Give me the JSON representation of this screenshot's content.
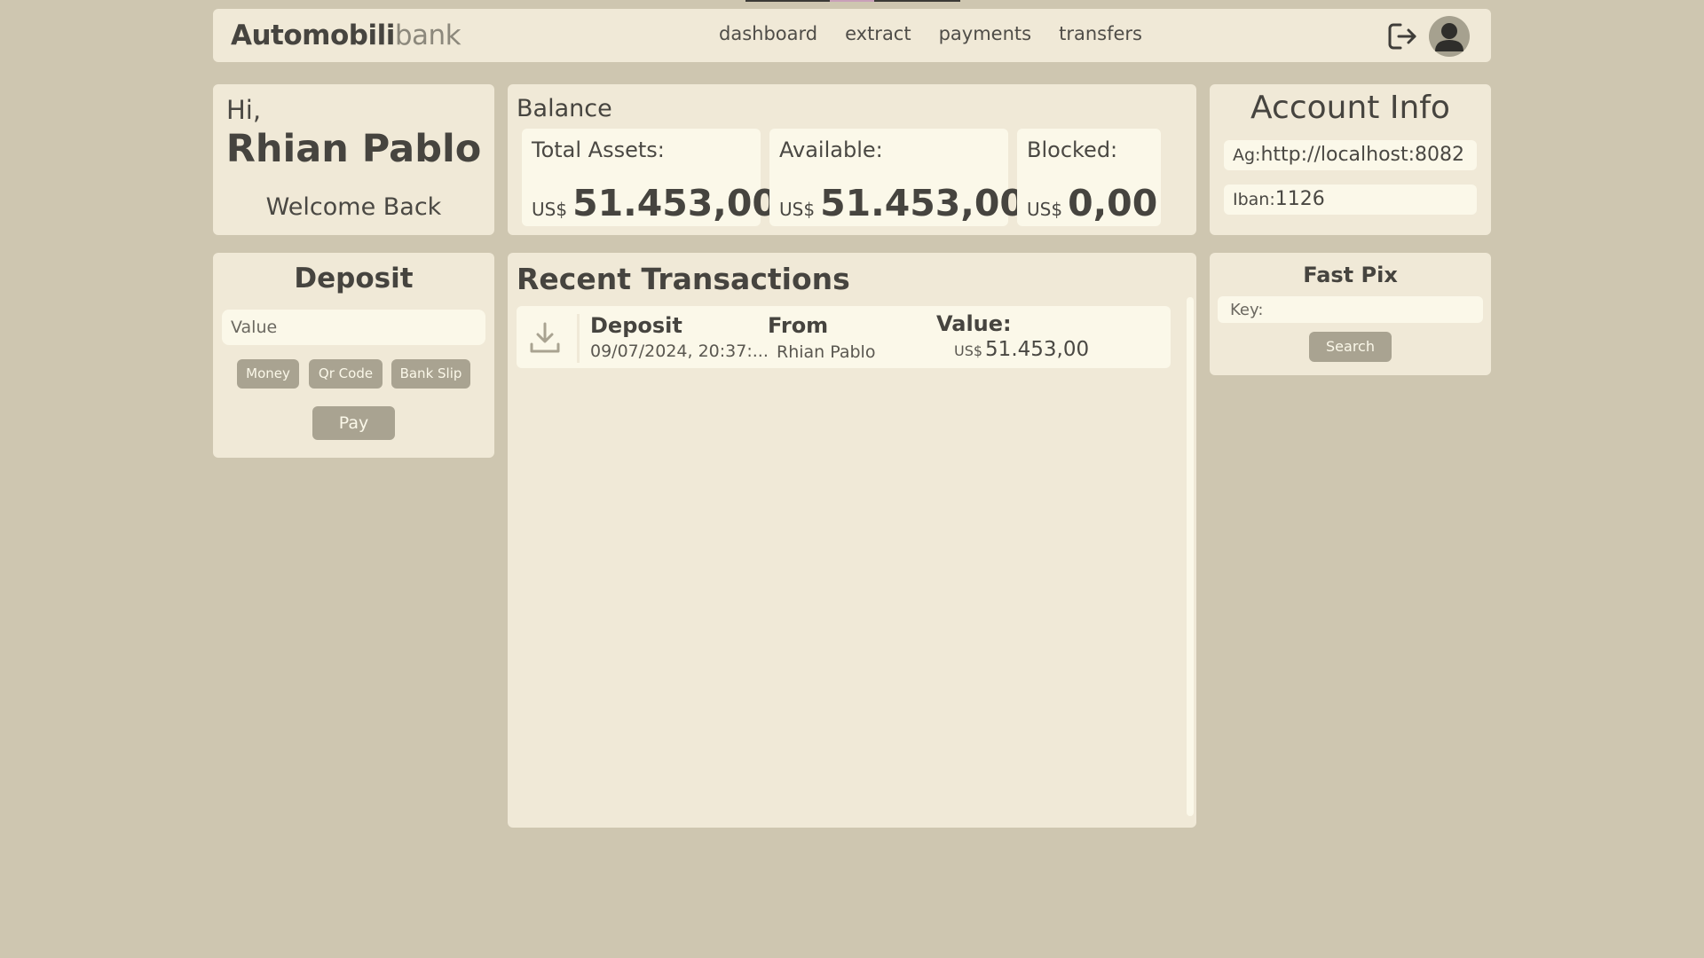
{
  "header": {
    "brand_strong": "Automobili",
    "brand_light": "bank",
    "nav": [
      "dashboard",
      "extract",
      "payments",
      "transfers"
    ],
    "icons": {
      "logout": "logout-icon",
      "avatar": "user-avatar-icon"
    }
  },
  "greeting": {
    "hi": "Hi,",
    "name": "Rhian Pablo",
    "welcome": "Welcome Back"
  },
  "balance": {
    "title": "Balance",
    "total": {
      "label": "Total Assets:",
      "currency": "US$",
      "value": "51.453,00"
    },
    "available": {
      "label": "Available:",
      "currency": "US$",
      "value": "51.453,00"
    },
    "blocked": {
      "label": "Blocked:",
      "currency": "US$",
      "value": "0,00"
    }
  },
  "account": {
    "title": "Account Info",
    "agency_key": "Ag:",
    "agency_value": "http://localhost:8082",
    "iban_key": "Iban:",
    "iban_value": "1126"
  },
  "deposit": {
    "title": "Deposit",
    "value_placeholder": "Value",
    "methods": [
      "Money",
      "Qr Code",
      "Bank Slip"
    ],
    "pay": "Pay"
  },
  "recent": {
    "title": "Recent Transactions",
    "transactions": [
      {
        "type": "Deposit",
        "date": "09/07/2024, 20:37:...",
        "from_label": "From",
        "from": "Rhian Pablo",
        "value_label": "Value:",
        "currency": "US$",
        "value": "51.453,00",
        "icon": "download-icon"
      }
    ]
  },
  "fastpix": {
    "title": "Fast Pix",
    "key_placeholder": "Key:",
    "search": "Search"
  },
  "colors": {
    "background": "#cec6b0",
    "card": "#f0e9d7",
    "inner": "#fbf8e9",
    "button": "#a9a391",
    "text": "#4a4843"
  }
}
